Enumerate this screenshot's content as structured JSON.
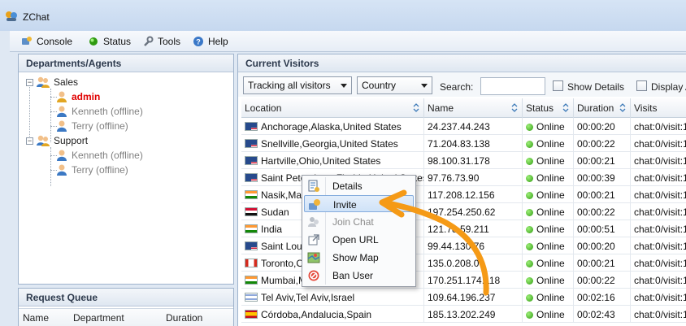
{
  "window": {
    "title": "ZChat"
  },
  "menu": [
    {
      "label": "Console",
      "icon": "console-icon"
    },
    {
      "label": "Status",
      "icon": "status-dot-icon"
    },
    {
      "label": "Tools",
      "icon": "wrench-icon"
    },
    {
      "label": "Help",
      "icon": "help-icon"
    }
  ],
  "departments": {
    "heading": "Departments/Agents",
    "groups": [
      {
        "name": "Sales",
        "agents": [
          {
            "name": "admin",
            "status": "online"
          },
          {
            "name": "Kenneth (offline)",
            "status": "offline"
          },
          {
            "name": "Terry (offline)",
            "status": "offline"
          }
        ]
      },
      {
        "name": "Support",
        "agents": [
          {
            "name": "Kenneth (offline)",
            "status": "offline"
          },
          {
            "name": "Terry (offline)",
            "status": "offline"
          }
        ]
      }
    ]
  },
  "queue": {
    "heading": "Request Queue",
    "columns": [
      "Name",
      "Department",
      "Duration"
    ]
  },
  "visitors": {
    "heading": "Current Visitors",
    "tracking_filter": "Tracking all visitors",
    "country_filter": "Country",
    "search_label": "Search:",
    "search_value": "",
    "show_details_label": "Show Details",
    "display_label": "Display A",
    "columns": [
      "Location",
      "Name",
      "Status",
      "Duration",
      "Visits"
    ],
    "rows": [
      {
        "flag": "us",
        "location": "Anchorage,Alaska,United States",
        "name": "24.237.44.243",
        "status": "Online",
        "duration": "00:00:20",
        "visits": "chat:0/visit:1"
      },
      {
        "flag": "us",
        "location": "Snellville,Georgia,United States",
        "name": "71.204.83.138",
        "status": "Online",
        "duration": "00:00:22",
        "visits": "chat:0/visit:1"
      },
      {
        "flag": "us",
        "location": "Hartville,Ohio,United States",
        "name": "98.100.31.178",
        "status": "Online",
        "duration": "00:00:21",
        "visits": "chat:0/visit:1"
      },
      {
        "flag": "us",
        "location": "Saint Petersburg,Florida,United States",
        "name": "97.76.73.90",
        "status": "Online",
        "duration": "00:00:39",
        "visits": "chat:0/visit:1"
      },
      {
        "flag": "in",
        "location": "Nasik,Maharashtra,India",
        "name": "117.208.12.156",
        "status": "Online",
        "duration": "00:00:21",
        "visits": "chat:0/visit:1"
      },
      {
        "flag": "sd",
        "location": "Sudan",
        "name": "197.254.250.62",
        "status": "Online",
        "duration": "00:00:22",
        "visits": "chat:0/visit:1"
      },
      {
        "flag": "in",
        "location": "India",
        "name": "121.78.59.211",
        "status": "Online",
        "duration": "00:00:51",
        "visits": "chat:0/visit:1"
      },
      {
        "flag": "us",
        "location": "Saint Louis,Missouri,United States",
        "name": "99.44.130.76",
        "status": "Online",
        "duration": "00:00:20",
        "visits": "chat:0/visit:1"
      },
      {
        "flag": "ca",
        "location": "Toronto,Ontario,Canada",
        "name": "135.0.208.0",
        "status": "Online",
        "duration": "00:00:21",
        "visits": "chat:0/visit:1"
      },
      {
        "flag": "in",
        "location": "Mumbai,Maharashtra,India",
        "name": "170.251.174.118",
        "status": "Online",
        "duration": "00:00:22",
        "visits": "chat:0/visit:1"
      },
      {
        "flag": "il",
        "location": "Tel Aviv,Tel Aviv,Israel",
        "name": "109.64.196.237",
        "status": "Online",
        "duration": "00:02:16",
        "visits": "chat:0/visit:1"
      },
      {
        "flag": "es",
        "location": "Córdoba,Andalucia,Spain",
        "name": "185.13.202.249",
        "status": "Online",
        "duration": "00:02:43",
        "visits": "chat:0/visit:1"
      }
    ]
  },
  "context_menu": {
    "items": [
      {
        "label": "Details",
        "icon": "details-icon",
        "state": "normal"
      },
      {
        "label": "Invite",
        "icon": "invite-icon",
        "state": "highlighted"
      },
      {
        "label": "Join Chat",
        "icon": "join-chat-icon",
        "state": "disabled"
      },
      {
        "label": "Open URL",
        "icon": "open-url-icon",
        "state": "normal"
      },
      {
        "label": "Show Map",
        "icon": "map-icon",
        "state": "normal"
      },
      {
        "label": "Ban User",
        "icon": "ban-icon",
        "state": "normal"
      }
    ]
  },
  "colors": {
    "admin_text": "#e00000",
    "offline_text": "#7f7f7f",
    "online_dot": "#3aa81a",
    "annotation_arrow": "#f59a16",
    "menu_highlight": "#cfe2f8"
  }
}
